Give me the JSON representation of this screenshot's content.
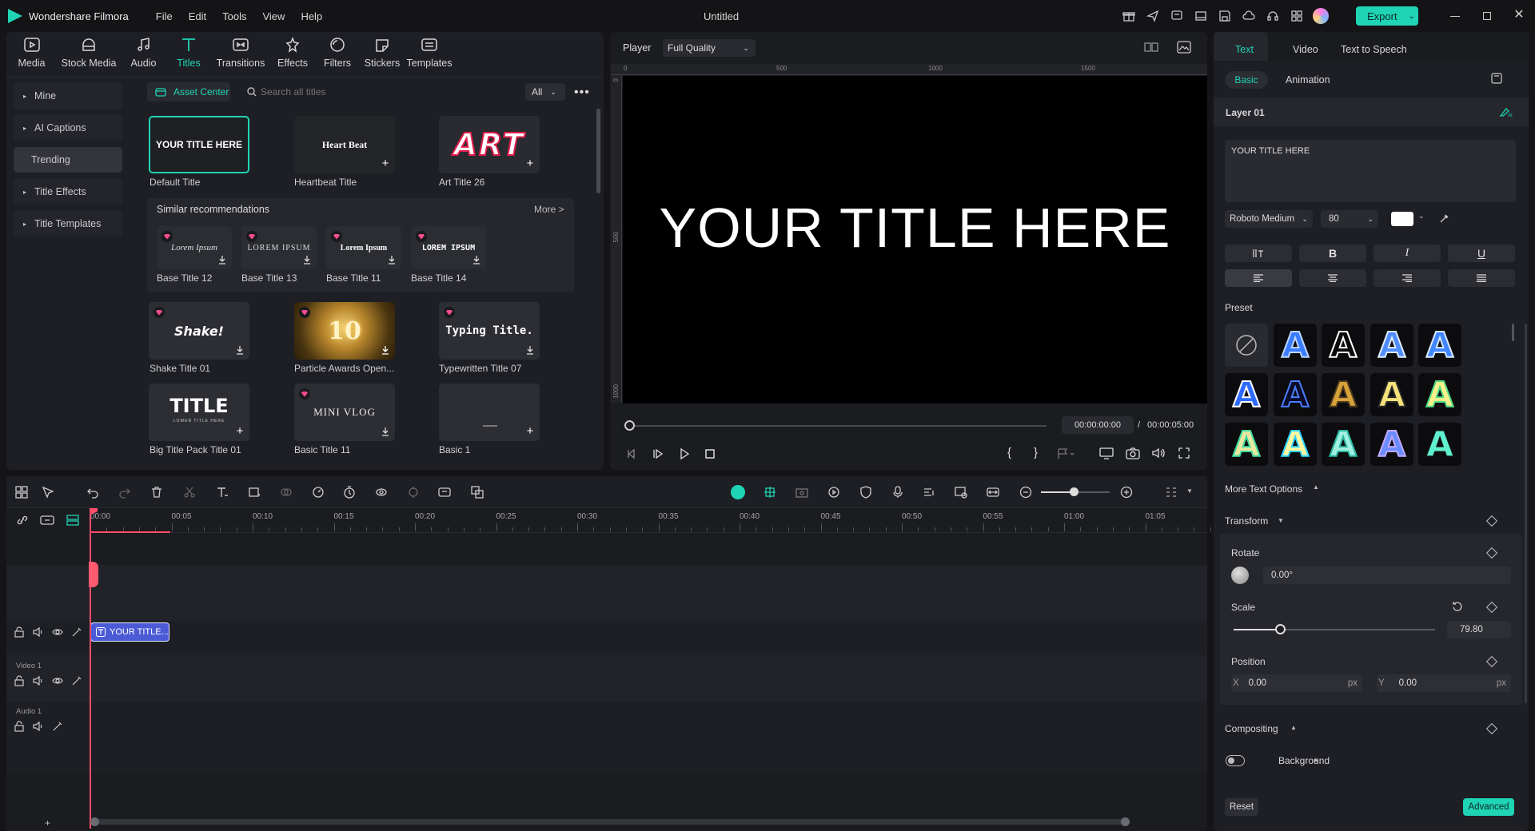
{
  "app": {
    "name": "Wondershare Filmora",
    "doc_title": "Untitled",
    "export_label": "Export"
  },
  "menu": [
    "File",
    "Edit",
    "Tools",
    "View",
    "Help"
  ],
  "toolbar": [
    {
      "label": "Media",
      "icon": "media-icon"
    },
    {
      "label": "Stock Media",
      "icon": "stock-media-icon"
    },
    {
      "label": "Audio",
      "icon": "audio-icon"
    },
    {
      "label": "Titles",
      "icon": "titles-icon",
      "active": true
    },
    {
      "label": "Transitions",
      "icon": "transitions-icon"
    },
    {
      "label": "Effects",
      "icon": "effects-icon"
    },
    {
      "label": "Filters",
      "icon": "filters-icon"
    },
    {
      "label": "Stickers",
      "icon": "stickers-icon"
    },
    {
      "label": "Templates",
      "icon": "templates-icon"
    }
  ],
  "sidebar": [
    "Mine",
    "AI Captions",
    "Trending",
    "Title Effects",
    "Title Templates"
  ],
  "library": {
    "asset_center": "Asset Center",
    "search_placeholder": "Search all titles",
    "filter": "All",
    "row1": [
      {
        "label": "Default Title",
        "thumb": "YOUR TITLE HERE"
      },
      {
        "label": "Heartbeat Title",
        "thumb": "Heart Beat"
      },
      {
        "label": "Art Title 26",
        "thumb": "ART"
      }
    ],
    "similar_title": "Similar recommendations",
    "more": "More >",
    "similar": [
      {
        "label": "Base Title 12",
        "thumb": "Lorem Ipsum"
      },
      {
        "label": "Base Title 13",
        "thumb": "LOREM IPSUM"
      },
      {
        "label": "Base Title 11",
        "thumb": "Lorem Ipsum"
      },
      {
        "label": "Base Title 14",
        "thumb": "LOREM IPSUM"
      }
    ],
    "row2": [
      {
        "label": "Shake Title 01",
        "thumb": "Shake!"
      },
      {
        "label": "Particle Awards Open...",
        "thumb": "10"
      },
      {
        "label": "Typewritten Title 07",
        "thumb": "Typing Title."
      }
    ],
    "row3": [
      {
        "label": "Big Title Pack Title 01",
        "thumb": "TITLE",
        "sub": "LOWER TITLE HERE"
      },
      {
        "label": "Basic Title 11",
        "thumb": "MINI VLOG"
      },
      {
        "label": "Basic 1",
        "thumb": ""
      }
    ]
  },
  "player": {
    "label": "Player",
    "quality": "Full Quality",
    "ruler": [
      "0",
      "500",
      "1000",
      "1500"
    ],
    "vruler": [
      "0",
      "500",
      "1000"
    ],
    "preview_text": "YOUR TITLE HERE",
    "current_time": "00:00:00:00",
    "separator": "/",
    "total_time": "00:00:05:00"
  },
  "right": {
    "tabs": [
      "Text",
      "Video",
      "Text to Speech"
    ],
    "subtabs": [
      "Basic",
      "Animation"
    ],
    "layer": "Layer 01",
    "text_value": "YOUR TITLE HERE",
    "font": "Roboto Medium",
    "font_size": "80",
    "text_color": "#ffffff",
    "bold": "B",
    "italic": "I",
    "underline": "U",
    "preset_label": "Preset",
    "preset_glyph": "A",
    "more_options": "More Text Options",
    "transform": "Transform",
    "rotate": "Rotate",
    "rotate_value": "0.00°",
    "scale": "Scale",
    "scale_value": "79.80",
    "scale_fraction": 0.23,
    "position": "Position",
    "x_label": "X",
    "x_value": "0.00",
    "y_label": "Y",
    "y_value": "0.00",
    "unit": "px",
    "compositing": "Compositing",
    "background": "Background",
    "reset": "Reset",
    "advanced": "Advanced"
  },
  "timeline": {
    "ticks": [
      "00:00",
      "00:05",
      "00:10",
      "00:15",
      "00:20",
      "00:25",
      "00:30",
      "00:35",
      "00:40",
      "00:45",
      "00:50",
      "00:55",
      "01:00",
      "01:05"
    ],
    "clip_label": "YOUR TITLE...",
    "video_track": "Video 1",
    "audio_track": "Audio 1"
  },
  "colors": {
    "accent": "#1fd4b4",
    "clip": "#4b5bd6",
    "playhead": "#ff4d6a"
  }
}
